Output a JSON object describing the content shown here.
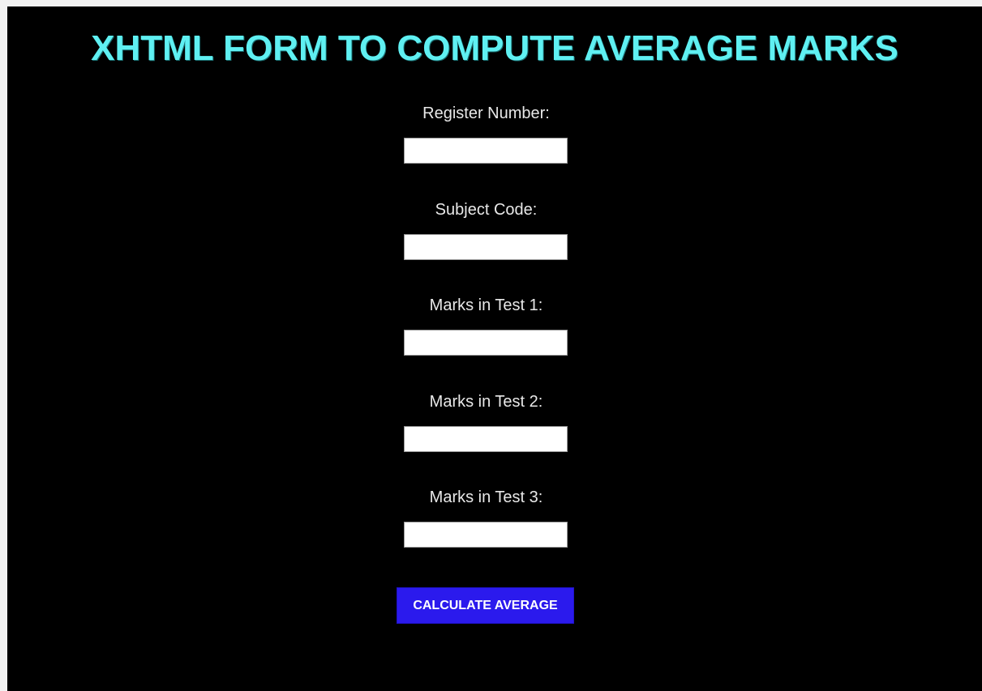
{
  "page": {
    "title": "XHTML FORM TO COMPUTE AVERAGE MARKS"
  },
  "form": {
    "fields": [
      {
        "label": "Register Number:",
        "value": "",
        "placeholder": ""
      },
      {
        "label": "Subject Code:",
        "value": "",
        "placeholder": ""
      },
      {
        "label": "Marks in Test 1:",
        "value": "",
        "placeholder": ""
      },
      {
        "label": "Marks in Test 2:",
        "value": "",
        "placeholder": ""
      },
      {
        "label": "Marks in Test 3:",
        "value": "",
        "placeholder": ""
      }
    ],
    "submit_label": "CALCULATE AVERAGE"
  },
  "colors": {
    "background": "#000000",
    "title": "#5ff0f2",
    "label": "#e8e8e8",
    "button": "#2b1aed"
  }
}
